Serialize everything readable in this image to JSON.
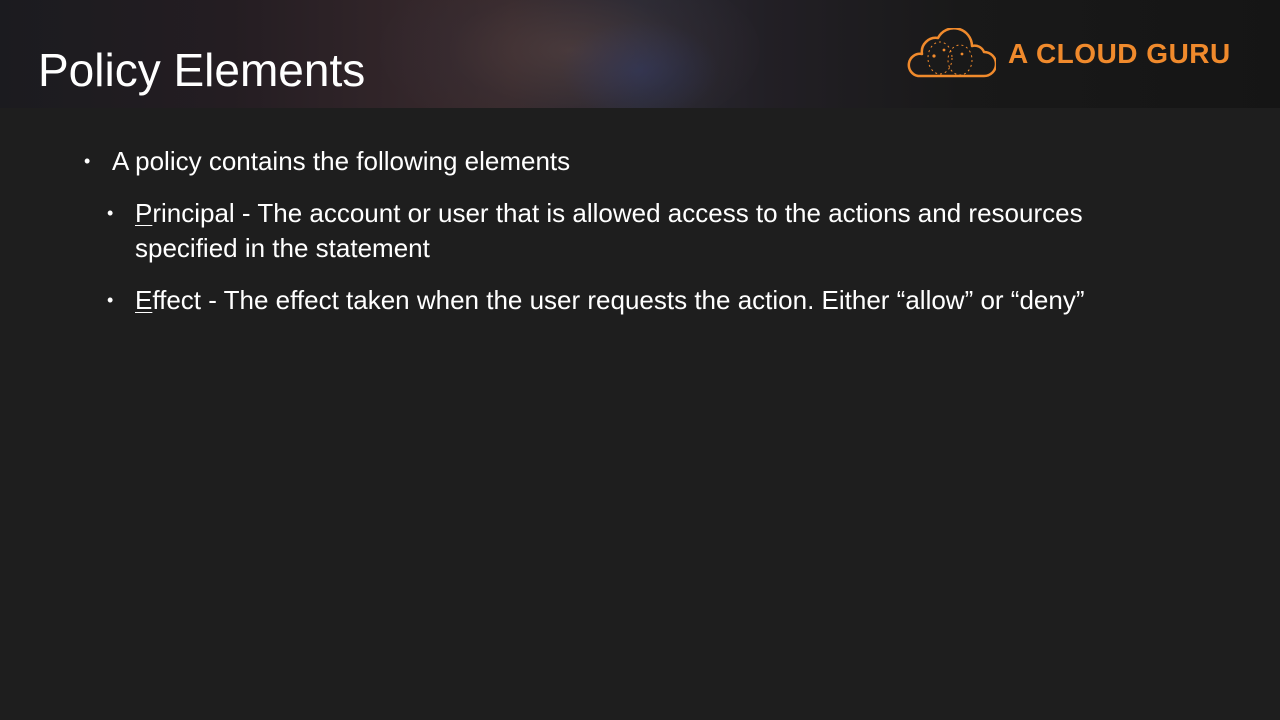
{
  "slide": {
    "title": "Policy Elements",
    "brand": {
      "name": "A CLOUD GURU",
      "color": "#f08a2c",
      "icon": "cloud-logo-icon"
    },
    "bullets": [
      {
        "text": "A policy contains the following elements",
        "level": 1
      },
      {
        "level": 2,
        "underlined": "P",
        "rest": "rincipal - The account or user that is allowed access to the actions and resources specified in the statement"
      },
      {
        "level": 2,
        "underlined": "E",
        "rest": "ffect - The effect taken when the user requests the action.  Either “allow” or “deny”"
      }
    ],
    "bullet_glyph": "•"
  }
}
